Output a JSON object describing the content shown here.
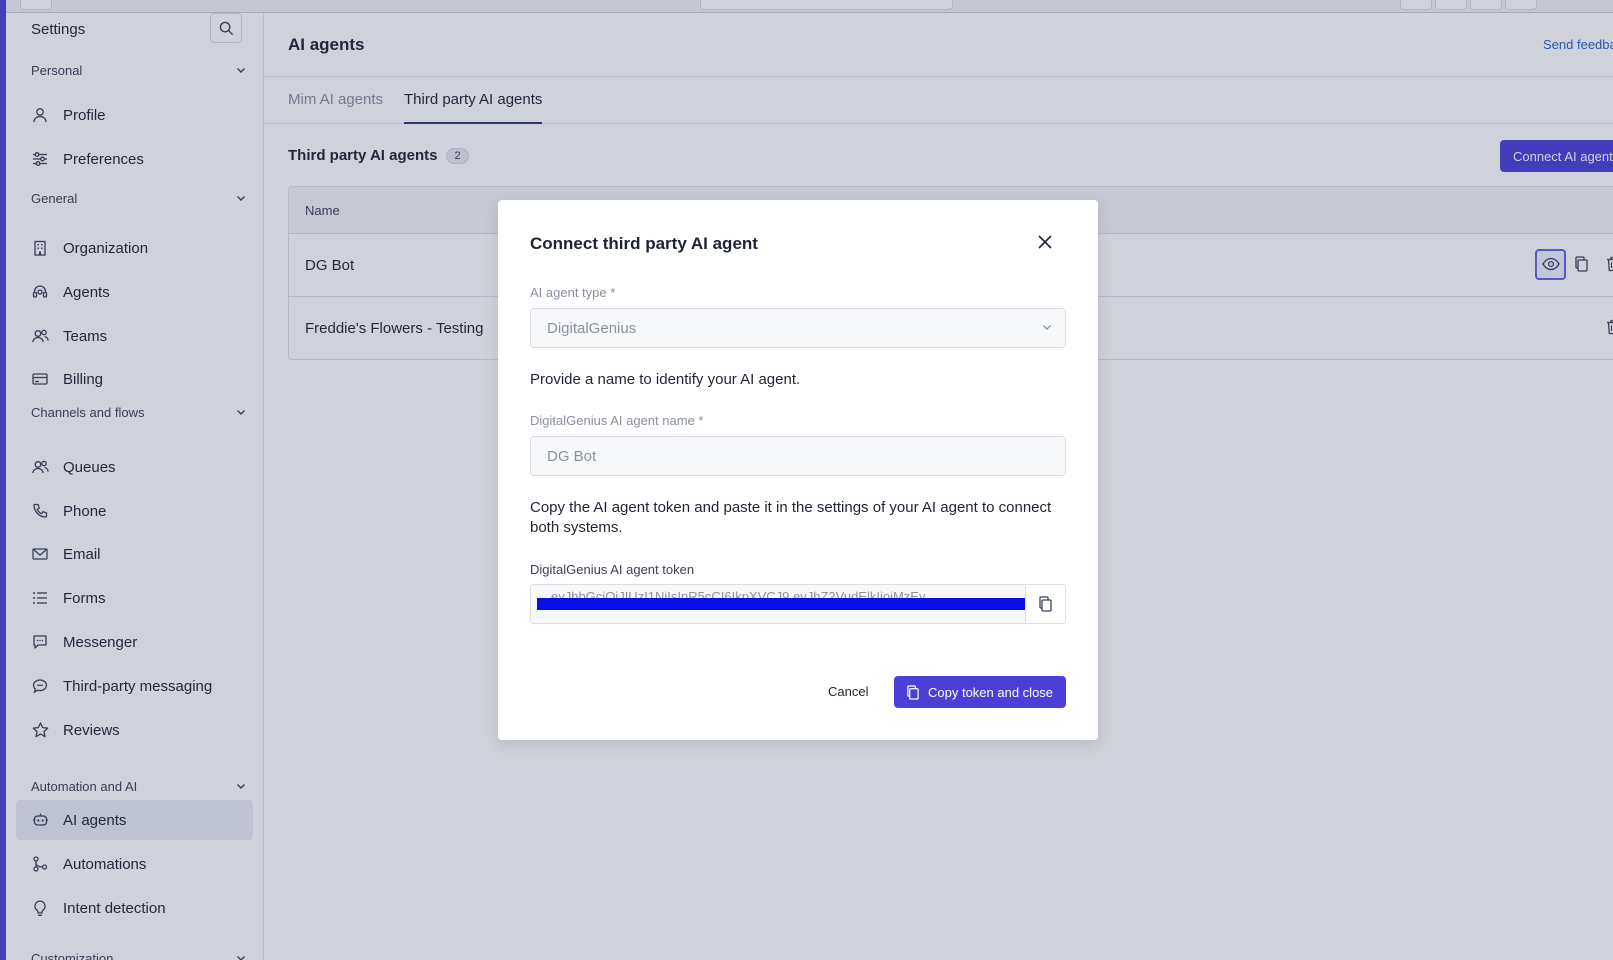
{
  "sidebar": {
    "title": "Settings",
    "sections": [
      {
        "label": "Personal"
      },
      {
        "label": "General"
      },
      {
        "label": "Channels and flows"
      },
      {
        "label": "Automation and AI"
      },
      {
        "label": "Customization"
      }
    ],
    "items": [
      {
        "label": "Profile",
        "icon": "user-icon"
      },
      {
        "label": "Preferences",
        "icon": "sliders-icon"
      },
      {
        "label": "Organization",
        "icon": "building-icon"
      },
      {
        "label": "Agents",
        "icon": "headset-icon"
      },
      {
        "label": "Teams",
        "icon": "people-icon"
      },
      {
        "label": "Billing",
        "icon": "credit-card-icon"
      },
      {
        "label": "Queues",
        "icon": "people-icon"
      },
      {
        "label": "Phone",
        "icon": "phone-icon"
      },
      {
        "label": "Email",
        "icon": "envelope-icon"
      },
      {
        "label": "Forms",
        "icon": "list-icon"
      },
      {
        "label": "Messenger",
        "icon": "chat-icon"
      },
      {
        "label": "Third-party messaging",
        "icon": "chat-bubble-icon"
      },
      {
        "label": "Reviews",
        "icon": "star-icon"
      },
      {
        "label": "AI agents",
        "icon": "robot-icon",
        "active": true
      },
      {
        "label": "Automations",
        "icon": "flow-icon"
      },
      {
        "label": "Intent detection",
        "icon": "lightbulb-icon"
      }
    ]
  },
  "main": {
    "title": "AI agents",
    "feedback": "Send feedback",
    "tabs": [
      {
        "label": "Mim AI agents"
      },
      {
        "label": "Third party AI agents",
        "active": true
      }
    ],
    "section_title": "Third party AI agents",
    "count": "2",
    "connect_button": "Connect AI agent",
    "table": {
      "column_name": "Name",
      "rows": [
        {
          "name": "DG Bot"
        },
        {
          "name": "Freddie's Flowers - Testing"
        }
      ]
    }
  },
  "modal": {
    "title": "Connect third party AI agent",
    "type_label": "AI agent type *",
    "type_value": "DigitalGenius",
    "name_prompt": "Provide a name to identify your AI agent.",
    "name_label": "DigitalGenius AI agent name *",
    "name_value": "DG Bot",
    "token_prompt": "Copy the AI agent token and paste it in the settings of your AI agent to connect both systems.",
    "token_label": "DigitalGenius AI agent token",
    "token_value": "eyJhbGciOiJIUzI1NiIsInR5cCI6IkpXVCJ9.eyJhZ2VudElkIjoiMzEy",
    "cancel": "Cancel",
    "primary": "Copy token and close"
  },
  "colors": {
    "accent": "#4b3fd8",
    "link": "#2464c4",
    "redaction": "#0a0fe8"
  }
}
